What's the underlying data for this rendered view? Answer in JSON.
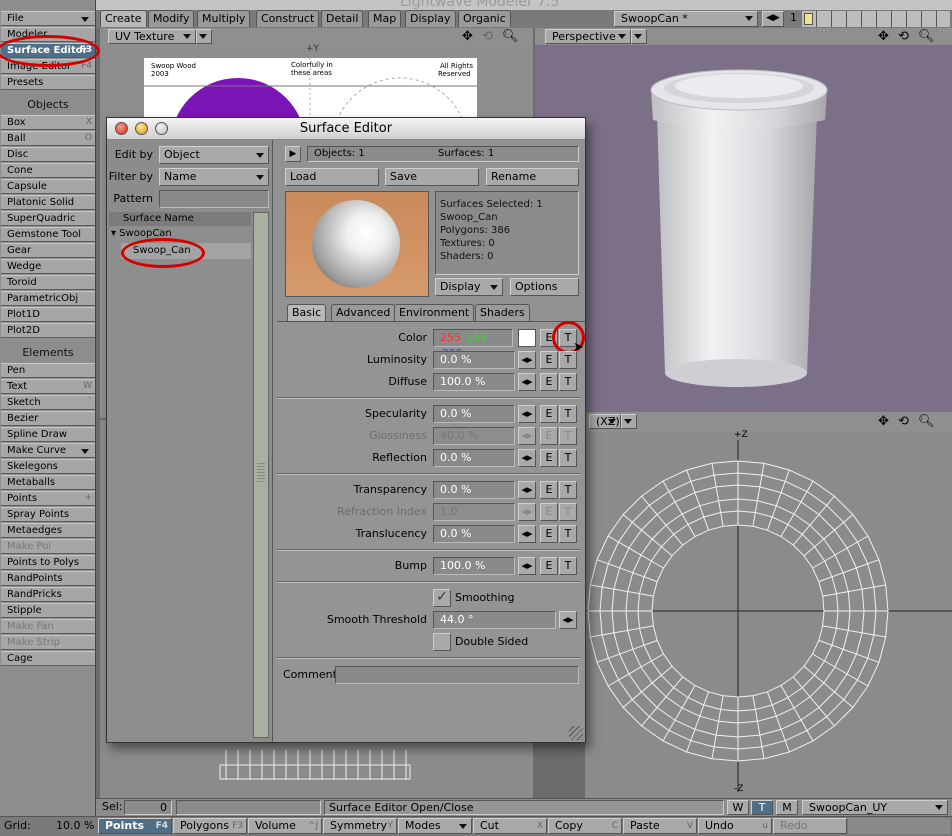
{
  "app": {
    "window_title": "Lightwave Modeler 7.5"
  },
  "left_toolbar": {
    "top_buttons": [
      {
        "label": "File",
        "key": ""
      },
      {
        "label": "Modeler",
        "key": ""
      },
      {
        "label": "Surface Editor",
        "key": "F3"
      },
      {
        "label": "Image Editor",
        "key": "F4"
      },
      {
        "label": "Presets",
        "key": ""
      }
    ],
    "objects_header": "Objects",
    "objects": [
      {
        "label": "Box",
        "key": "X"
      },
      {
        "label": "Ball",
        "key": "O"
      },
      {
        "label": "Disc",
        "key": ""
      },
      {
        "label": "Cone",
        "key": ""
      },
      {
        "label": "Capsule",
        "key": ""
      },
      {
        "label": "Platonic Solid",
        "key": ""
      },
      {
        "label": "SuperQuadric",
        "key": ""
      },
      {
        "label": "Gemstone Tool",
        "key": ""
      },
      {
        "label": "Gear",
        "key": ""
      },
      {
        "label": "Wedge",
        "key": ""
      },
      {
        "label": "Toroid",
        "key": ""
      },
      {
        "label": "ParametricObj",
        "key": ""
      },
      {
        "label": "Plot1D",
        "key": ""
      },
      {
        "label": "Plot2D",
        "key": ""
      }
    ],
    "elements_header": "Elements",
    "elements": [
      {
        "label": "Pen",
        "key": ""
      },
      {
        "label": "Text",
        "key": "W"
      },
      {
        "label": "Sketch",
        "key": "`"
      },
      {
        "label": "Bezier",
        "key": ""
      },
      {
        "label": "Spline Draw",
        "key": ""
      },
      {
        "label": "Make Curve",
        "key": ""
      },
      {
        "label": "Skelegons",
        "key": ""
      },
      {
        "label": "Metaballs",
        "key": ""
      },
      {
        "label": "Points",
        "key": "+"
      },
      {
        "label": "Spray Points",
        "key": ""
      },
      {
        "label": "Metaedges",
        "key": ""
      },
      {
        "label": "Make Pol",
        "key": ""
      },
      {
        "label": "Points to Polys",
        "key": ""
      },
      {
        "label": "RandPoints",
        "key": ""
      },
      {
        "label": "RandPricks",
        "key": ""
      },
      {
        "label": "Stipple",
        "key": ""
      },
      {
        "label": "Make Fan",
        "key": ""
      },
      {
        "label": "Make Strip",
        "key": ""
      },
      {
        "label": "Cage",
        "key": ""
      }
    ]
  },
  "top_tabs": [
    "Create",
    "Modify",
    "Multiply",
    "Construct",
    "Detail",
    "Map",
    "Display",
    "Organic"
  ],
  "layer": {
    "object_name": "SwoopCan *",
    "layer_number": "1"
  },
  "viewports": {
    "top_left": {
      "mode": "UV Texture",
      "axis": "+Y",
      "texture_text": [
        "Swoop Wood",
        "2003",
        "Colorfully in",
        "these areas",
        "All Rights",
        "Reserved"
      ]
    },
    "top_right": {
      "mode": "Perspective"
    },
    "bottom_right": {
      "mode": "(XZ)",
      "axis_top": "+Z",
      "axis_bottom": "-Z"
    }
  },
  "surface_editor": {
    "title": "Surface Editor",
    "edit_by_label": "Edit by",
    "edit_by_value": "Object",
    "filter_by_label": "Filter by",
    "filter_by_value": "Name",
    "pattern_label": "Pattern",
    "pattern_value": "",
    "list_header": "Surface Name",
    "tree_object": "SwoopCan",
    "tree_surface": "Swoop_Can",
    "objects_count": "Objects: 1",
    "surfaces_count": "Surfaces: 1",
    "load": "Load",
    "save": "Save",
    "rename": "Rename",
    "info": {
      "selected": "Surfaces Selected: 1",
      "name": "Swoop_Can",
      "polygons": "Polygons: 386",
      "textures": "Textures: 0",
      "shaders": "Shaders: 0"
    },
    "display_btn": "Display",
    "options_btn": "Options",
    "tabs": [
      "Basic",
      "Advanced",
      "Environment",
      "Shaders"
    ],
    "color": {
      "label": "Color",
      "r": "255",
      "g": "255",
      "b": "255"
    },
    "params": [
      {
        "label": "Luminosity",
        "value": "0.0 %",
        "disabled": false
      },
      {
        "label": "Diffuse",
        "value": "100.0 %",
        "disabled": false
      },
      {
        "label": "Specularity",
        "value": "0.0 %",
        "disabled": false
      },
      {
        "label": "Glossiness",
        "value": "40.0 %",
        "disabled": true
      },
      {
        "label": "Reflection",
        "value": "0.0 %",
        "disabled": false
      },
      {
        "label": "Transparency",
        "value": "0.0 %",
        "disabled": false
      },
      {
        "label": "Refraction Index",
        "value": "1.0",
        "disabled": true
      },
      {
        "label": "Translucency",
        "value": "0.0 %",
        "disabled": false
      },
      {
        "label": "Bump",
        "value": "100.0 %",
        "disabled": false
      }
    ],
    "e_btn": "E",
    "t_btn": "T",
    "smoothing": "Smoothing",
    "smooth_threshold_label": "Smooth Threshold",
    "smooth_threshold_value": "44.0 °",
    "double_sided": "Double Sided",
    "comment_label": "Comment",
    "comment_value": ""
  },
  "status": {
    "sel_label": "Sel:",
    "sel_value": "0",
    "message": "Surface Editor Open/Close",
    "w": "W",
    "t": "T",
    "m": "M",
    "uv_map": "SwoopCan_UY",
    "grid_label": "Grid:",
    "grid_value": "10.0 %"
  },
  "bottom_bar": [
    {
      "label": "Points",
      "key": "F4"
    },
    {
      "label": "Polygons",
      "key": "F3"
    },
    {
      "label": "Volume",
      "key": "^J"
    },
    {
      "label": "Symmetry",
      "key": "Y"
    },
    {
      "label": "Modes",
      "key": ""
    },
    {
      "label": "Cut",
      "key": "X"
    },
    {
      "label": "Copy",
      "key": "C"
    },
    {
      "label": "Paste",
      "key": "V"
    },
    {
      "label": "Undo",
      "key": "u"
    },
    {
      "label": "Redo",
      "key": ""
    }
  ],
  "colors": {
    "viewport_bg": "#7c7088",
    "accent_red": "#d40000",
    "texture_purple": "#7a14b4"
  }
}
